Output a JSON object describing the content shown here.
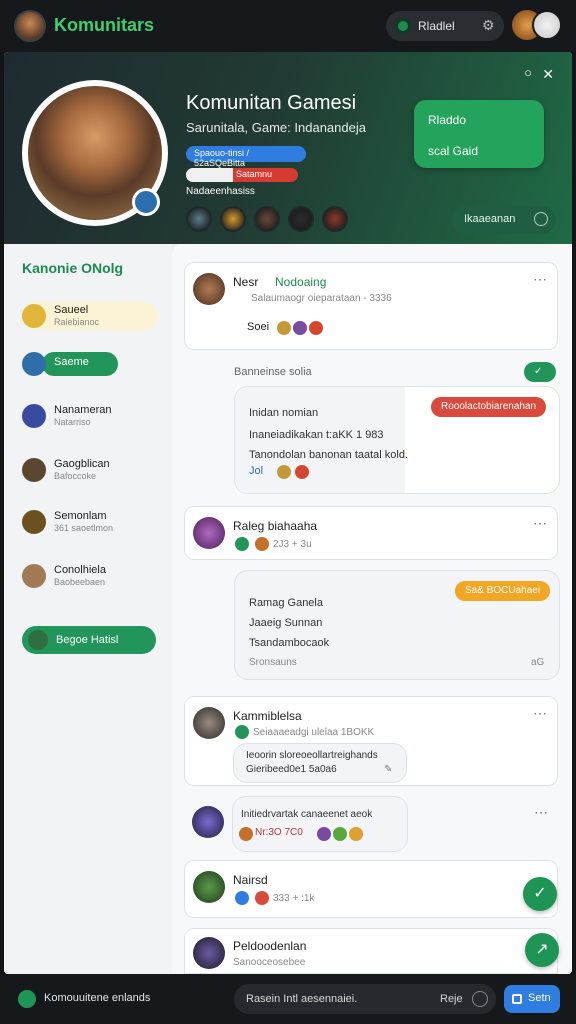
{
  "topbar": {
    "app_title": "Komunitars",
    "pill_label": "Rladlel",
    "gear_icon": "gear-icon"
  },
  "banner": {
    "title": "Komunitan Gamesi",
    "subtitle": "Sarunitala, Game: Indanandeja",
    "blue_pill": "Spaouo-tinsi / 52aSQeBitta",
    "red_bar_text": "Satamnu",
    "red_bar_progress": 0.42,
    "members_label": "Nadaeenhasiss",
    "card_line1": "Rladdo",
    "card_line2": "scal Gaid",
    "button_label": "Ikaaeanan",
    "member_colors": [
      "#5a7d8a",
      "#d69b32",
      "#6b4a3a",
      "#2c2c2c",
      "#8a3a2a"
    ]
  },
  "sidebar": {
    "title": "Kanonie ONolg",
    "items": [
      {
        "t1": "Saueel",
        "t2": "Ralebianoc",
        "color": "#e0b53a"
      },
      {
        "t1": "Saeme",
        "t2": "",
        "color": "#2f6ea8"
      },
      {
        "t1": "Nanameran",
        "t2": "Natarriso",
        "color": "#3a4aa0"
      },
      {
        "t1": "Gaogblican",
        "t2": "Bafoccoke",
        "color": "#5b4630"
      },
      {
        "t1": "Semonlam",
        "t2": "361 saoetlmon",
        "color": "#6b5020"
      },
      {
        "t1": "Conolhiela",
        "t2": "Baobeebaen",
        "color": "#a07a55"
      }
    ],
    "active_label": "Begoe Hatisl"
  },
  "feed": {
    "post1": {
      "name": "Nesr",
      "verified": "Nodoaing",
      "meta": "Salaumaogr oieparataan - 3336",
      "reaction_label": "Soei"
    },
    "section_label": "Banneinse solia",
    "card2": {
      "chip": "Rooolactobiarenahan",
      "line1": "Inidan nomian",
      "line2": "Inaneiadikakan  t:aKK 1 983",
      "line3": "Tanondolan banonan taatal kold.",
      "emoji_label": "Jol"
    },
    "post2": {
      "name": "Raleg biahaaha",
      "meta": "2J3 + 3u"
    },
    "card3": {
      "chip": "Sa& BOCUahaei",
      "line1": "Ramag Ganela",
      "line2": "Jaaeig Sunnan",
      "line3": "Tsandambocaok",
      "line4": "Sronsauns",
      "corner": "aG"
    },
    "post3": {
      "name": "Kammiblelsa",
      "meta": "Seiaaaeadgi ulelaa 1BOKK",
      "bubble1": "Ieoorin sloreoeollartreighands",
      "bubble2": "Gieribeed0e1 5a0a6"
    },
    "post4": {
      "bubble": "Initiedrvartak canaeenet aeok",
      "emoji_line": "Nr:3O 7C0"
    },
    "post5": {
      "name": "Nairsd",
      "meta": "333 + :1k"
    },
    "post6": {
      "name": "Peldoodenlan",
      "meta": "Sanooceosebee"
    }
  },
  "bottombar": {
    "label": "Komouuitene enlands",
    "placeholder": "Rasein Intl aesennaiei.",
    "right_label": "Reje",
    "send_label": "Setn"
  }
}
